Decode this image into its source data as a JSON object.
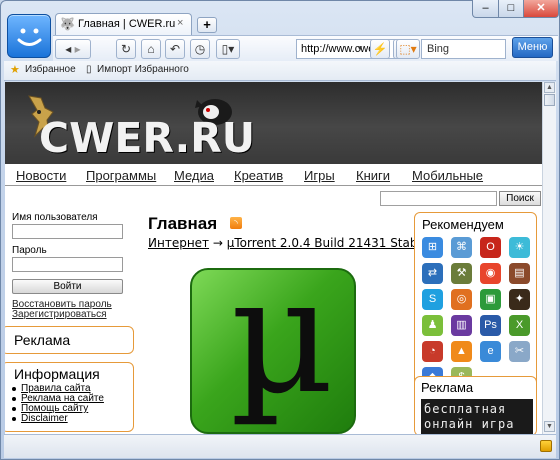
{
  "browser": {
    "tab_title": "Главная | CWER.ru",
    "tab_close": "×",
    "new_tab": "+",
    "address": "http://www.cwer.ru",
    "search_value": "Bing",
    "menu_label": "Меню",
    "win_min": "–",
    "win_max": "□",
    "win_close": "✕",
    "bookmarks": [
      "Избранное",
      "Импорт Избранного"
    ]
  },
  "site": {
    "brand": "CWER.RU",
    "nav": [
      "Новости",
      "Программы",
      "Медиа",
      "Креатив",
      "Игры",
      "Книги",
      "Мобильные"
    ],
    "search_button": "Поиск"
  },
  "login": {
    "username_label": "Имя пользователя",
    "password_label": "Пароль",
    "login_button": "Войти",
    "restore_link": "Восстановить пароль",
    "register_link": "Зарегистрироваться"
  },
  "ads_left": {
    "title": "Реклама"
  },
  "info": {
    "title": "Информация",
    "links": [
      "Правила сайта",
      "Реклама на сайте",
      "Помощь сайту",
      "Disclaimer"
    ]
  },
  "main": {
    "title": "Главная",
    "crumb_section": "Интернет",
    "crumb_arrow": "→",
    "crumb_item": "µTorrent 2.0.4 Build 21431 Stable",
    "logo_glyph": "µ"
  },
  "recommend": {
    "title": "Рекомендуем",
    "icons": [
      {
        "name": "windows-icon",
        "color": "#3a8be0",
        "glyph": "⊞"
      },
      {
        "name": "network-icon",
        "color": "#5a9bd5",
        "glyph": "⌘"
      },
      {
        "name": "opera-icon",
        "color": "#c7261b",
        "glyph": "O"
      },
      {
        "name": "weather-icon",
        "color": "#3dbbd8",
        "glyph": "☀"
      },
      {
        "name": "teamviewer-icon",
        "color": "#2c6fbb",
        "glyph": "⇄"
      },
      {
        "name": "tools-icon",
        "color": "#6b7c3a",
        "glyph": "⚒"
      },
      {
        "name": "chrome-icon",
        "color": "#e8452c",
        "glyph": "◉"
      },
      {
        "name": "books-icon",
        "color": "#8b4a2b",
        "glyph": "▤"
      },
      {
        "name": "skype-icon",
        "color": "#1fa0e0",
        "glyph": "S"
      },
      {
        "name": "firefox-icon",
        "color": "#e07020",
        "glyph": "◎"
      },
      {
        "name": "video-icon",
        "color": "#2c9a3a",
        "glyph": "▣"
      },
      {
        "name": "bat-icon",
        "color": "#3a2a1a",
        "glyph": "✦"
      },
      {
        "name": "android-icon",
        "color": "#7bbf3a",
        "glyph": "♟"
      },
      {
        "name": "winrar-icon",
        "color": "#6a3aa0",
        "glyph": "▥"
      },
      {
        "name": "photoshop-icon",
        "color": "#2a5aa8",
        "glyph": "Ps"
      },
      {
        "name": "xbox-icon",
        "color": "#4a9a2a",
        "glyph": "X"
      },
      {
        "name": "clock-icon",
        "color": "#c83a2a",
        "glyph": "◔"
      },
      {
        "name": "vlc-icon",
        "color": "#f08a1a",
        "glyph": "▲"
      },
      {
        "name": "ie-icon",
        "color": "#3a8ad8",
        "glyph": "e"
      },
      {
        "name": "tool2-icon",
        "color": "#8aa8c8",
        "glyph": "✂"
      },
      {
        "name": "shopping-icon",
        "color": "#3a7ad8",
        "glyph": "◆"
      },
      {
        "name": "money-icon",
        "color": "#9ab85a",
        "glyph": "$"
      }
    ]
  },
  "ads_right": {
    "title": "Реклама",
    "banner_line1": "бесплатная",
    "banner_line2": "онлайн игра"
  }
}
